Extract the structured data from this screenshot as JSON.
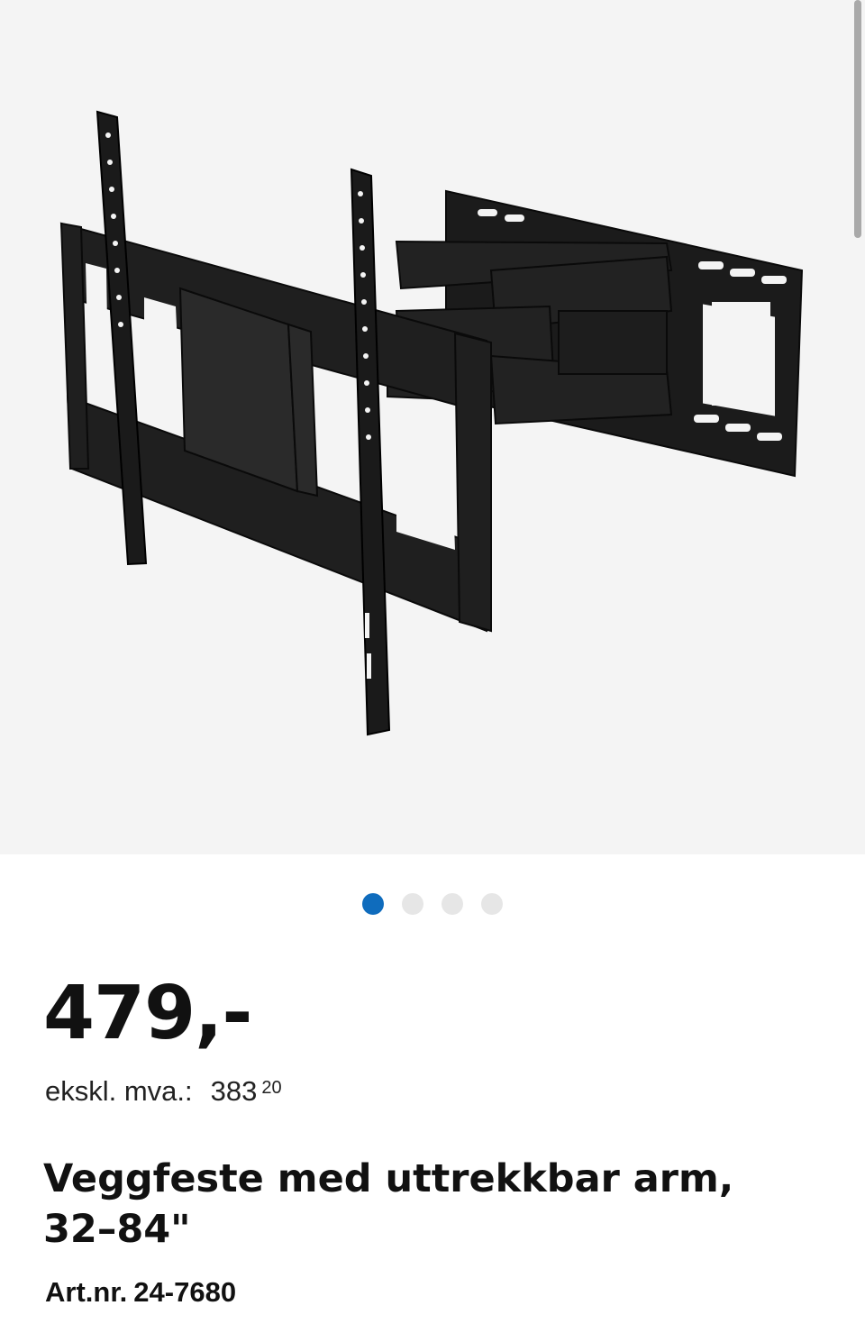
{
  "product_image": {
    "icon": "tv-wall-mount-product-image",
    "background": "#f4f4f4"
  },
  "carousel": {
    "active_index": 0,
    "count": 4,
    "active_color": "#0f6cbd",
    "inactive_color": "#e6e6e6"
  },
  "price": {
    "value": "479,-",
    "ex_vat_label": "ekskl. mva.:",
    "ex_vat_whole": "383",
    "ex_vat_cents": "20"
  },
  "product": {
    "title": "Veggfeste med uttrekkbar arm, 32–84\"",
    "art_label": "Art.nr.",
    "art_number": "24-7680"
  }
}
